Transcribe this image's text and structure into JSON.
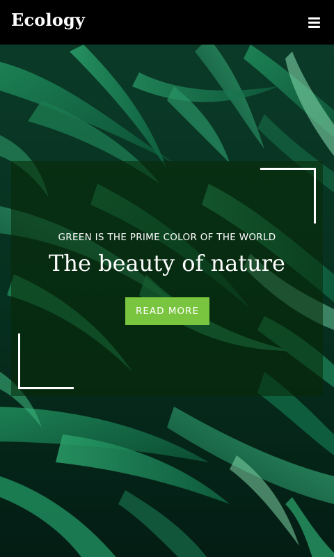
{
  "navbar": {
    "logo": "Ecology",
    "menu_icon": "hamburger-menu-icon"
  },
  "hero": {
    "background": "dark green leaves photo",
    "eyebrow": "GREEN IS THE PRIME COLOR OF THE WORLD",
    "title": "The beauty of nature",
    "cta_label": "READ MORE"
  },
  "colors": {
    "navbar_bg": "#000000",
    "accent": "#7ac53f",
    "text": "#ffffff"
  }
}
